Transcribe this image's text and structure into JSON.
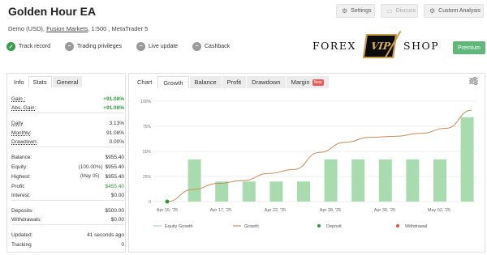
{
  "header": {
    "title": "Golden Hour EA",
    "subtitle_pre": "Demo (USD), ",
    "broker": "Fusion Markets",
    "subtitle_post": ", 1:500 , MetaTrader 5"
  },
  "toolbar": {
    "settings_label": "Settings",
    "discuss_label": "Discuss",
    "custom_label": "Custom Analysis"
  },
  "pills": {
    "track": "Track record",
    "trading": "Trading privileges",
    "live": "Live update",
    "cashback": "Cashback"
  },
  "logo": {
    "left": "FOREX",
    "vip": "VIP",
    "right": "SHOP"
  },
  "premium_label": "Premium",
  "left_tabs": {
    "info": "Info",
    "stats": "Stats",
    "general": "General"
  },
  "stats": {
    "gain": {
      "label": "Gain :",
      "value": "+91.08%"
    },
    "abs_gain": {
      "label": "Abs. Gain:",
      "value": "+91.08%"
    },
    "daily": {
      "label": "Daily",
      "value": "3.13%"
    },
    "monthly": {
      "label": "Monthly:",
      "value": "91.08%"
    },
    "drawdown": {
      "label": "Drawdown:",
      "value": "0.00%"
    },
    "balance": {
      "label": "Balance:",
      "value": "$955.40"
    },
    "equity": {
      "label": "Equity:",
      "mid": "(100.00%)",
      "value": "$955.40"
    },
    "highest": {
      "label": "Highest:",
      "mid": "(May 05)",
      "value": "$955.40"
    },
    "profit": {
      "label": "Profit:",
      "value": "$455.40"
    },
    "interest": {
      "label": "Interest:",
      "value": "$0.00"
    },
    "deposits": {
      "label": "Deposits:",
      "value": "$500.00"
    },
    "withdrawals": {
      "label": "Withdrawals:",
      "value": "$0.00"
    },
    "updated": {
      "label": "Updated:",
      "value": "41 seconds ago"
    },
    "tracking": {
      "label": "Tracking",
      "value": "0"
    }
  },
  "right_tabs": {
    "chart": "Chart",
    "growth": "Growth",
    "balance": "Balance",
    "profit": "Profit",
    "drawdown": "Drawdown",
    "margin": "Margin",
    "new_badge": "New"
  },
  "colors": {
    "bar": "#a8dcae",
    "line": "#c98c5a",
    "deposit": "#2e9a40",
    "withdrawal": "#e0533a",
    "grid": "#e8e8e8"
  },
  "chart_data": {
    "type": "bar",
    "y_tick_labels": [
      "0",
      "25%",
      "50%",
      "75%",
      "100%"
    ],
    "ylim": [
      0,
      100
    ],
    "x_tick_labels": [
      "Apr 15, '25",
      "Apr 17, '25",
      "Apr 22, '25",
      "Apr 28, '25",
      "Apr 30, '25",
      "May 02, '25"
    ],
    "bars": [
      0,
      42,
      20,
      20,
      20,
      20,
      42,
      42,
      42,
      42,
      42,
      84
    ],
    "series": [
      {
        "name": "Equity Growth",
        "values": [
          0,
          12,
          18,
          21,
          28,
          32,
          49,
          59,
          64,
          65,
          68,
          73,
          91
        ]
      },
      {
        "name": "Growth",
        "values": [
          0,
          42,
          20,
          20,
          20,
          20,
          42,
          42,
          42,
          42,
          42,
          84
        ]
      }
    ],
    "legend": [
      "Equity Growth",
      "Growth",
      "Deposit",
      "Withdrawal"
    ]
  }
}
